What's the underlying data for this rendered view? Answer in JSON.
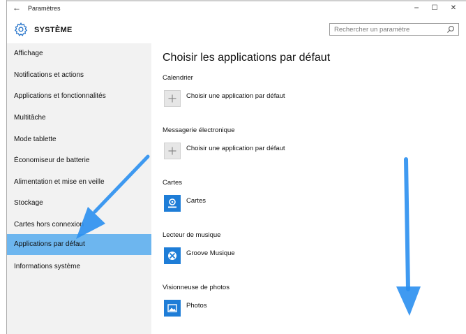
{
  "window": {
    "title": "Paramètres",
    "back_glyph": "←",
    "minimize_glyph": "−",
    "maximize_glyph": "☐",
    "close_glyph": "✕"
  },
  "header": {
    "title": "SYSTÈME",
    "icon": "gear-icon",
    "search_placeholder": "Rechercher un paramètre"
  },
  "sidebar": {
    "items": [
      {
        "label": "Affichage"
      },
      {
        "label": "Notifications et actions"
      },
      {
        "label": "Applications et fonctionnalités"
      },
      {
        "label": "Multitâche"
      },
      {
        "label": "Mode tablette"
      },
      {
        "label": "Économiseur de batterie"
      },
      {
        "label": "Alimentation et mise en veille"
      },
      {
        "label": "Stockage"
      },
      {
        "label": "Cartes hors connexion"
      },
      {
        "label": "Applications par défaut",
        "selected": true
      },
      {
        "label": "Informations système"
      }
    ]
  },
  "main": {
    "title": "Choisir les applications par défaut",
    "sections": [
      {
        "label": "Calendrier",
        "app": "Choisir une application par défaut",
        "icon": "plus-icon"
      },
      {
        "label": "Messagerie électronique",
        "app": "Choisir une application par défaut",
        "icon": "plus-icon"
      },
      {
        "label": "Cartes",
        "app": "Cartes",
        "icon": "maps-icon"
      },
      {
        "label": "Lecteur de musique",
        "app": "Groove Musique",
        "icon": "groove-music-icon"
      },
      {
        "label": "Visionneuse de photos",
        "app": "Photos",
        "icon": "photos-icon"
      }
    ]
  },
  "colors": {
    "selected_item": "#6db6ef",
    "sidebar_bg": "#f2f2f2",
    "app_tile_blue": "#1e7dd7",
    "annotation_arrow": "#2a8ff0"
  }
}
